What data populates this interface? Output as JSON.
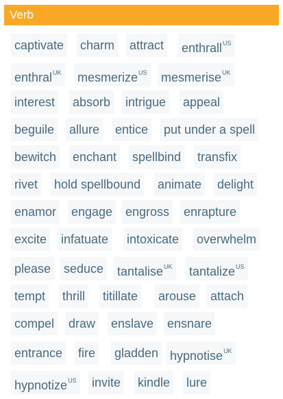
{
  "section": {
    "title": "Verb"
  },
  "words": [
    {
      "word": "captivate",
      "tag": ""
    },
    {
      "word": "charm",
      "tag": ""
    },
    {
      "word": "attract",
      "tag": ""
    },
    {
      "word": "enthrall",
      "tag": "US"
    },
    {
      "word": "enthral",
      "tag": "UK"
    },
    {
      "word": "mesmerize",
      "tag": "US"
    },
    {
      "word": "mesmerise",
      "tag": "UK"
    },
    {
      "word": "interest",
      "tag": ""
    },
    {
      "word": "absorb",
      "tag": ""
    },
    {
      "word": "intrigue",
      "tag": ""
    },
    {
      "word": "appeal",
      "tag": ""
    },
    {
      "word": "beguile",
      "tag": ""
    },
    {
      "word": "allure",
      "tag": ""
    },
    {
      "word": "entice",
      "tag": ""
    },
    {
      "word": "put under a spell",
      "tag": ""
    },
    {
      "word": "bewitch",
      "tag": ""
    },
    {
      "word": "enchant",
      "tag": ""
    },
    {
      "word": "spellbind",
      "tag": ""
    },
    {
      "word": "transfix",
      "tag": ""
    },
    {
      "word": "rivet",
      "tag": ""
    },
    {
      "word": "hold spellbound",
      "tag": ""
    },
    {
      "word": "animate",
      "tag": ""
    },
    {
      "word": "delight",
      "tag": ""
    },
    {
      "word": "enamor",
      "tag": ""
    },
    {
      "word": "engage",
      "tag": ""
    },
    {
      "word": "engross",
      "tag": ""
    },
    {
      "word": "enrapture",
      "tag": ""
    },
    {
      "word": "excite",
      "tag": ""
    },
    {
      "word": "infatuate",
      "tag": ""
    },
    {
      "word": "intoxicate",
      "tag": ""
    },
    {
      "word": "overwhelm",
      "tag": ""
    },
    {
      "word": "please",
      "tag": ""
    },
    {
      "word": "seduce",
      "tag": ""
    },
    {
      "word": "tantalise",
      "tag": "UK"
    },
    {
      "word": "tantalize",
      "tag": "US"
    },
    {
      "word": "tempt",
      "tag": ""
    },
    {
      "word": "thrill",
      "tag": ""
    },
    {
      "word": "titillate",
      "tag": ""
    },
    {
      "word": "arouse",
      "tag": ""
    },
    {
      "word": "attach",
      "tag": ""
    },
    {
      "word": "compel",
      "tag": ""
    },
    {
      "word": "draw",
      "tag": ""
    },
    {
      "word": "enslave",
      "tag": ""
    },
    {
      "word": "ensnare",
      "tag": ""
    },
    {
      "word": "entrance",
      "tag": ""
    },
    {
      "word": "fire",
      "tag": ""
    },
    {
      "word": "gladden",
      "tag": ""
    },
    {
      "word": "hypnotise",
      "tag": "UK"
    },
    {
      "word": "hypnotize",
      "tag": "US"
    },
    {
      "word": "invite",
      "tag": ""
    },
    {
      "word": "kindle",
      "tag": ""
    },
    {
      "word": "lure",
      "tag": ""
    }
  ]
}
